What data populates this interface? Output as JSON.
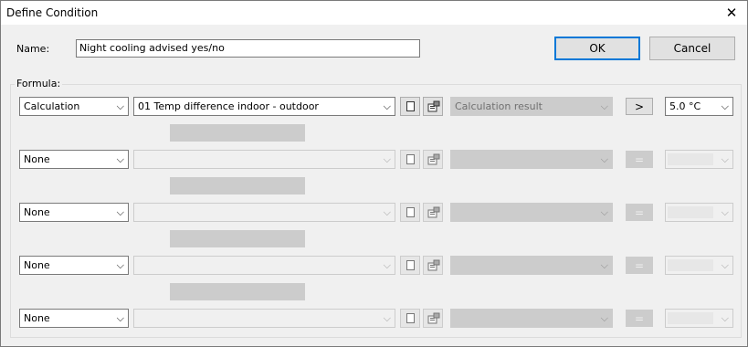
{
  "window": {
    "title": "Define Condition",
    "close_glyph": "✕"
  },
  "name_field": {
    "label": "Name:",
    "value": "Night cooling advised yes/no"
  },
  "buttons": {
    "ok": "OK",
    "cancel": "Cancel"
  },
  "formula": {
    "label": "Formula:",
    "rows": [
      {
        "type": "Calculation",
        "item": "01  Temp difference indoor - outdoor",
        "result": "Calculation result",
        "operator": ">",
        "value": "5.0 °C",
        "enabled": true
      },
      {
        "type": "None",
        "item": "",
        "result": "",
        "operator": "=",
        "value": "",
        "enabled": false
      },
      {
        "type": "None",
        "item": "",
        "result": "",
        "operator": "=",
        "value": "",
        "enabled": false
      },
      {
        "type": "None",
        "item": "",
        "result": "",
        "operator": "=",
        "value": "",
        "enabled": false
      },
      {
        "type": "None",
        "item": "",
        "result": "",
        "operator": "=",
        "value": "",
        "enabled": false
      }
    ]
  },
  "icons": {
    "dropdown_arrow": "⌵",
    "new_item": "new-document-icon",
    "properties": "properties-icon"
  }
}
